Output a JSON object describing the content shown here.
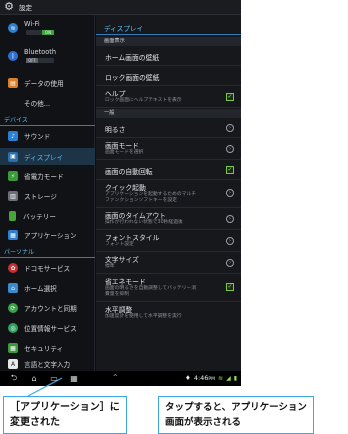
{
  "window": {
    "title": "設定"
  },
  "sidebar": {
    "items": [
      {
        "label": "Wi-Fi",
        "icon": "wifi-icon",
        "sub": "ON"
      },
      {
        "label": "Bluetooth",
        "icon": "bluetooth-icon",
        "sub": "OFF"
      },
      {
        "label": "データの使用",
        "icon": "data-usage-icon"
      },
      {
        "label": "その他...",
        "icon": ""
      }
    ],
    "device_header": "デバイス",
    "device_items": [
      {
        "label": "サウンド",
        "icon": "sound-icon"
      },
      {
        "label": "ディスプレイ",
        "icon": "display-icon",
        "active": true
      },
      {
        "label": "省電力モード",
        "icon": "power-saving-icon"
      },
      {
        "label": "ストレージ",
        "icon": "storage-icon"
      },
      {
        "label": "バッテリー",
        "icon": "battery-icon"
      },
      {
        "label": "アプリケーション",
        "icon": "apps-icon"
      }
    ],
    "personal_header": "パーソナル",
    "personal_items": [
      {
        "label": "ドコモサービス",
        "icon": "docomo-icon"
      },
      {
        "label": "ホーム選択",
        "icon": "home-icon"
      },
      {
        "label": "アカウントと同期",
        "icon": "sync-icon"
      },
      {
        "label": "位置情報サービス",
        "icon": "location-icon"
      },
      {
        "label": "セキュリティ",
        "icon": "security-icon"
      },
      {
        "label": "言語と文字入力",
        "icon": "language-icon"
      }
    ]
  },
  "content": {
    "header": "ディスプレイ",
    "cat1": "画面表示",
    "rows1": [
      {
        "title": "ホーム画面の壁紙"
      },
      {
        "title": "ロック画面の壁紙"
      },
      {
        "title": "ヘルプ",
        "desc": "ロック画面にヘルプテキストを表示",
        "check": true
      }
    ],
    "cat2": "一般",
    "rows2": [
      {
        "title": "明るさ"
      },
      {
        "title": "画面モード",
        "desc": "画面モードを選択"
      },
      {
        "title": "画面の自動回転",
        "check": true
      },
      {
        "title": "クイック起動",
        "desc1": "アプリケーションを起動するためのマルチ",
        "desc2": "ファンクションソフトキーを設定"
      },
      {
        "title": "画面のタイムアウト",
        "desc": "操作が行われない状態で30秒経過後"
      },
      {
        "title": "フォントスタイル",
        "desc": "フォント設定"
      },
      {
        "title": "文字サイズ",
        "desc": "標準"
      },
      {
        "title": "省エネモード",
        "desc1": "画面の明るさを自動調整してバッテリー消",
        "desc2": "費量を抑制",
        "check": true
      },
      {
        "title": "水平調整",
        "desc": "加速度計を使用して水平調整を実行"
      }
    ]
  },
  "navbar": {
    "time": "4:46",
    "time_suffix": "PM"
  },
  "callouts": {
    "left": {
      "line1": "［アプリケーション］に",
      "line2": "変更された"
    },
    "right": {
      "line1": "タップすると、アプリケーション",
      "line2": "画面が表示される"
    }
  },
  "colors": {
    "accent": "#4fc0ff",
    "check": "#8be04e",
    "callout_border": "#3aa9e8"
  }
}
